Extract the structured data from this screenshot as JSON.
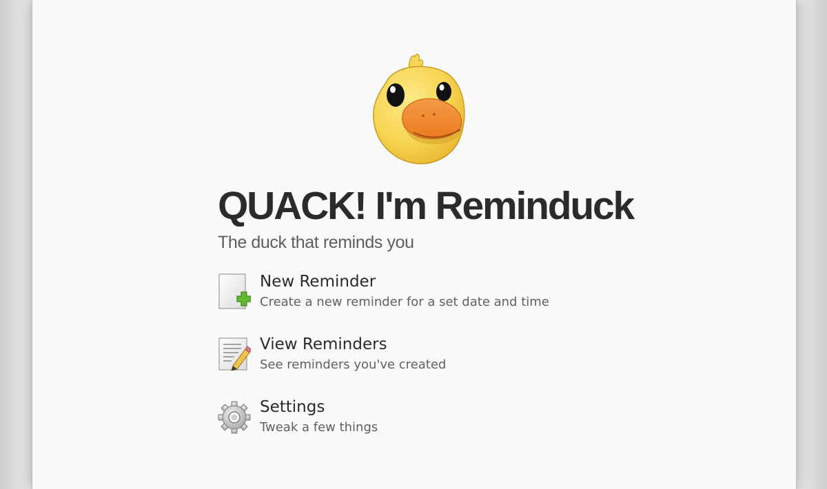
{
  "app": {
    "title": "QUACK! I'm Reminduck",
    "subtitle": "The duck that reminds you",
    "logo_icon": "duck-logo-icon"
  },
  "menu": {
    "items": [
      {
        "label": "New Reminder",
        "description": "Create a new reminder for a set date and time",
        "icon": "new-document-icon"
      },
      {
        "label": "View Reminders",
        "description": "See reminders you've created",
        "icon": "edit-document-icon"
      },
      {
        "label": "Settings",
        "description": "Tweak a few things",
        "icon": "gear-icon"
      }
    ]
  },
  "colors": {
    "background": "#fafafa",
    "title": "#2b2b2b",
    "subtitle": "#5e5e5e",
    "duck_yellow": "#f7d14c",
    "duck_beak": "#f08a2e",
    "plus_green": "#5cb82e"
  }
}
